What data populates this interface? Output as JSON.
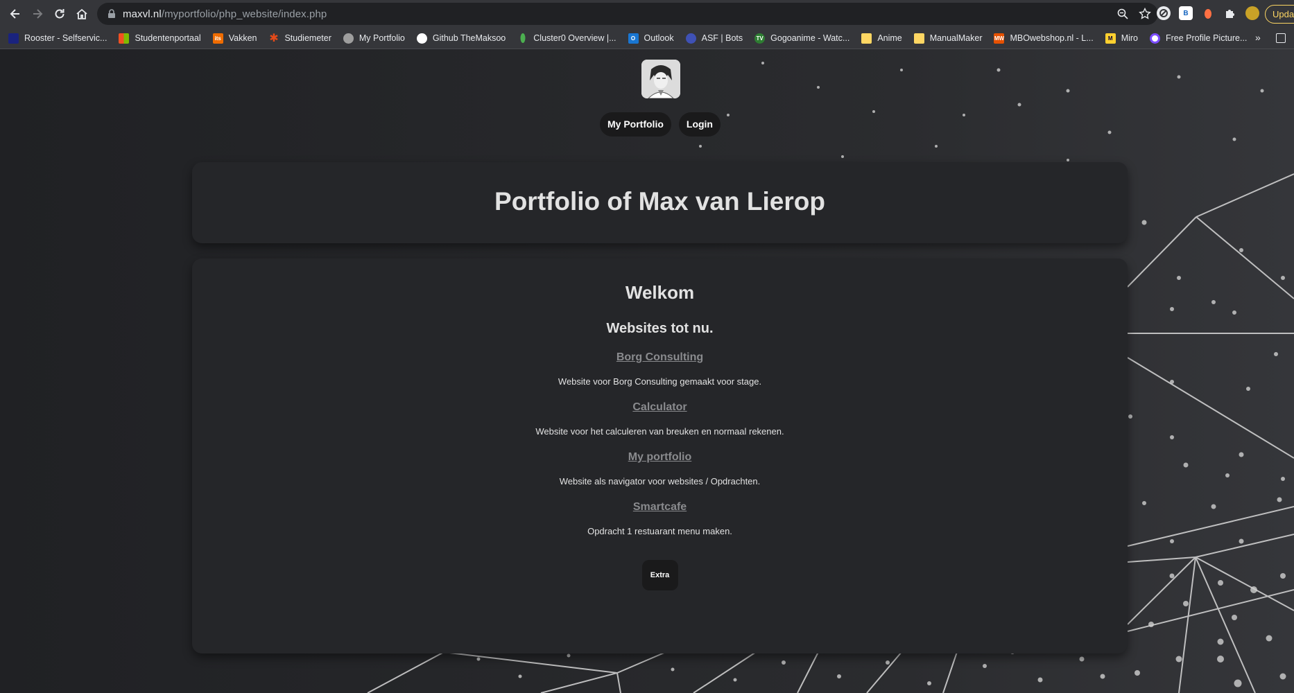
{
  "browser": {
    "url_host": "maxvl.nl",
    "url_path": "/myportfolio/php_website/index.php",
    "update_label": "Update",
    "bookmarks": [
      {
        "label": "Rooster - Selfservic...",
        "color": "#1a237e"
      },
      {
        "label": "Studentenportaal",
        "color": "#f25022"
      },
      {
        "label": "Vakken",
        "color": "#ef6c00"
      },
      {
        "label": "Studiemeter",
        "color": "#e64a19"
      },
      {
        "label": "My Portfolio",
        "color": "#9e9e9e"
      },
      {
        "label": "Github TheMaksoo",
        "color": "#ffffff"
      },
      {
        "label": "Cluster0 Overview |...",
        "color": "#4caf50"
      },
      {
        "label": "Outlook",
        "color": "#1976d2"
      },
      {
        "label": "ASF | Bots",
        "color": "#3f51b5"
      },
      {
        "label": "Gogoanime - Watc...",
        "color": "#2e7d32"
      },
      {
        "label": "Anime",
        "color": "#fdd663"
      },
      {
        "label": "ManualMaker",
        "color": "#fdd663"
      },
      {
        "label": "MBOwebshop.nl - L...",
        "color": "#e65100"
      },
      {
        "label": "Miro",
        "color": "#ffd02f"
      },
      {
        "label": "Free Profile Picture...",
        "color": "#7c4dff"
      }
    ]
  },
  "nav": {
    "portfolio_label": "My Portfolio",
    "login_label": "Login"
  },
  "header": {
    "title": "Portfolio of Max van Lierop"
  },
  "main": {
    "welcome": "Welkom",
    "subtitle": "Websites tot nu.",
    "sites": [
      {
        "name": "Borg Consulting",
        "description": "Website voor Borg Consulting gemaakt voor stage."
      },
      {
        "name": "Calculator",
        "description": "Website voor het calculeren van breuken en normaal rekenen."
      },
      {
        "name": "My portfolio",
        "description": "Website als navigator voor websites / Opdrachten."
      },
      {
        "name": "Smartcafe",
        "description": "Opdracht 1 restuarant menu maken."
      }
    ],
    "extra_label": "Extra"
  }
}
